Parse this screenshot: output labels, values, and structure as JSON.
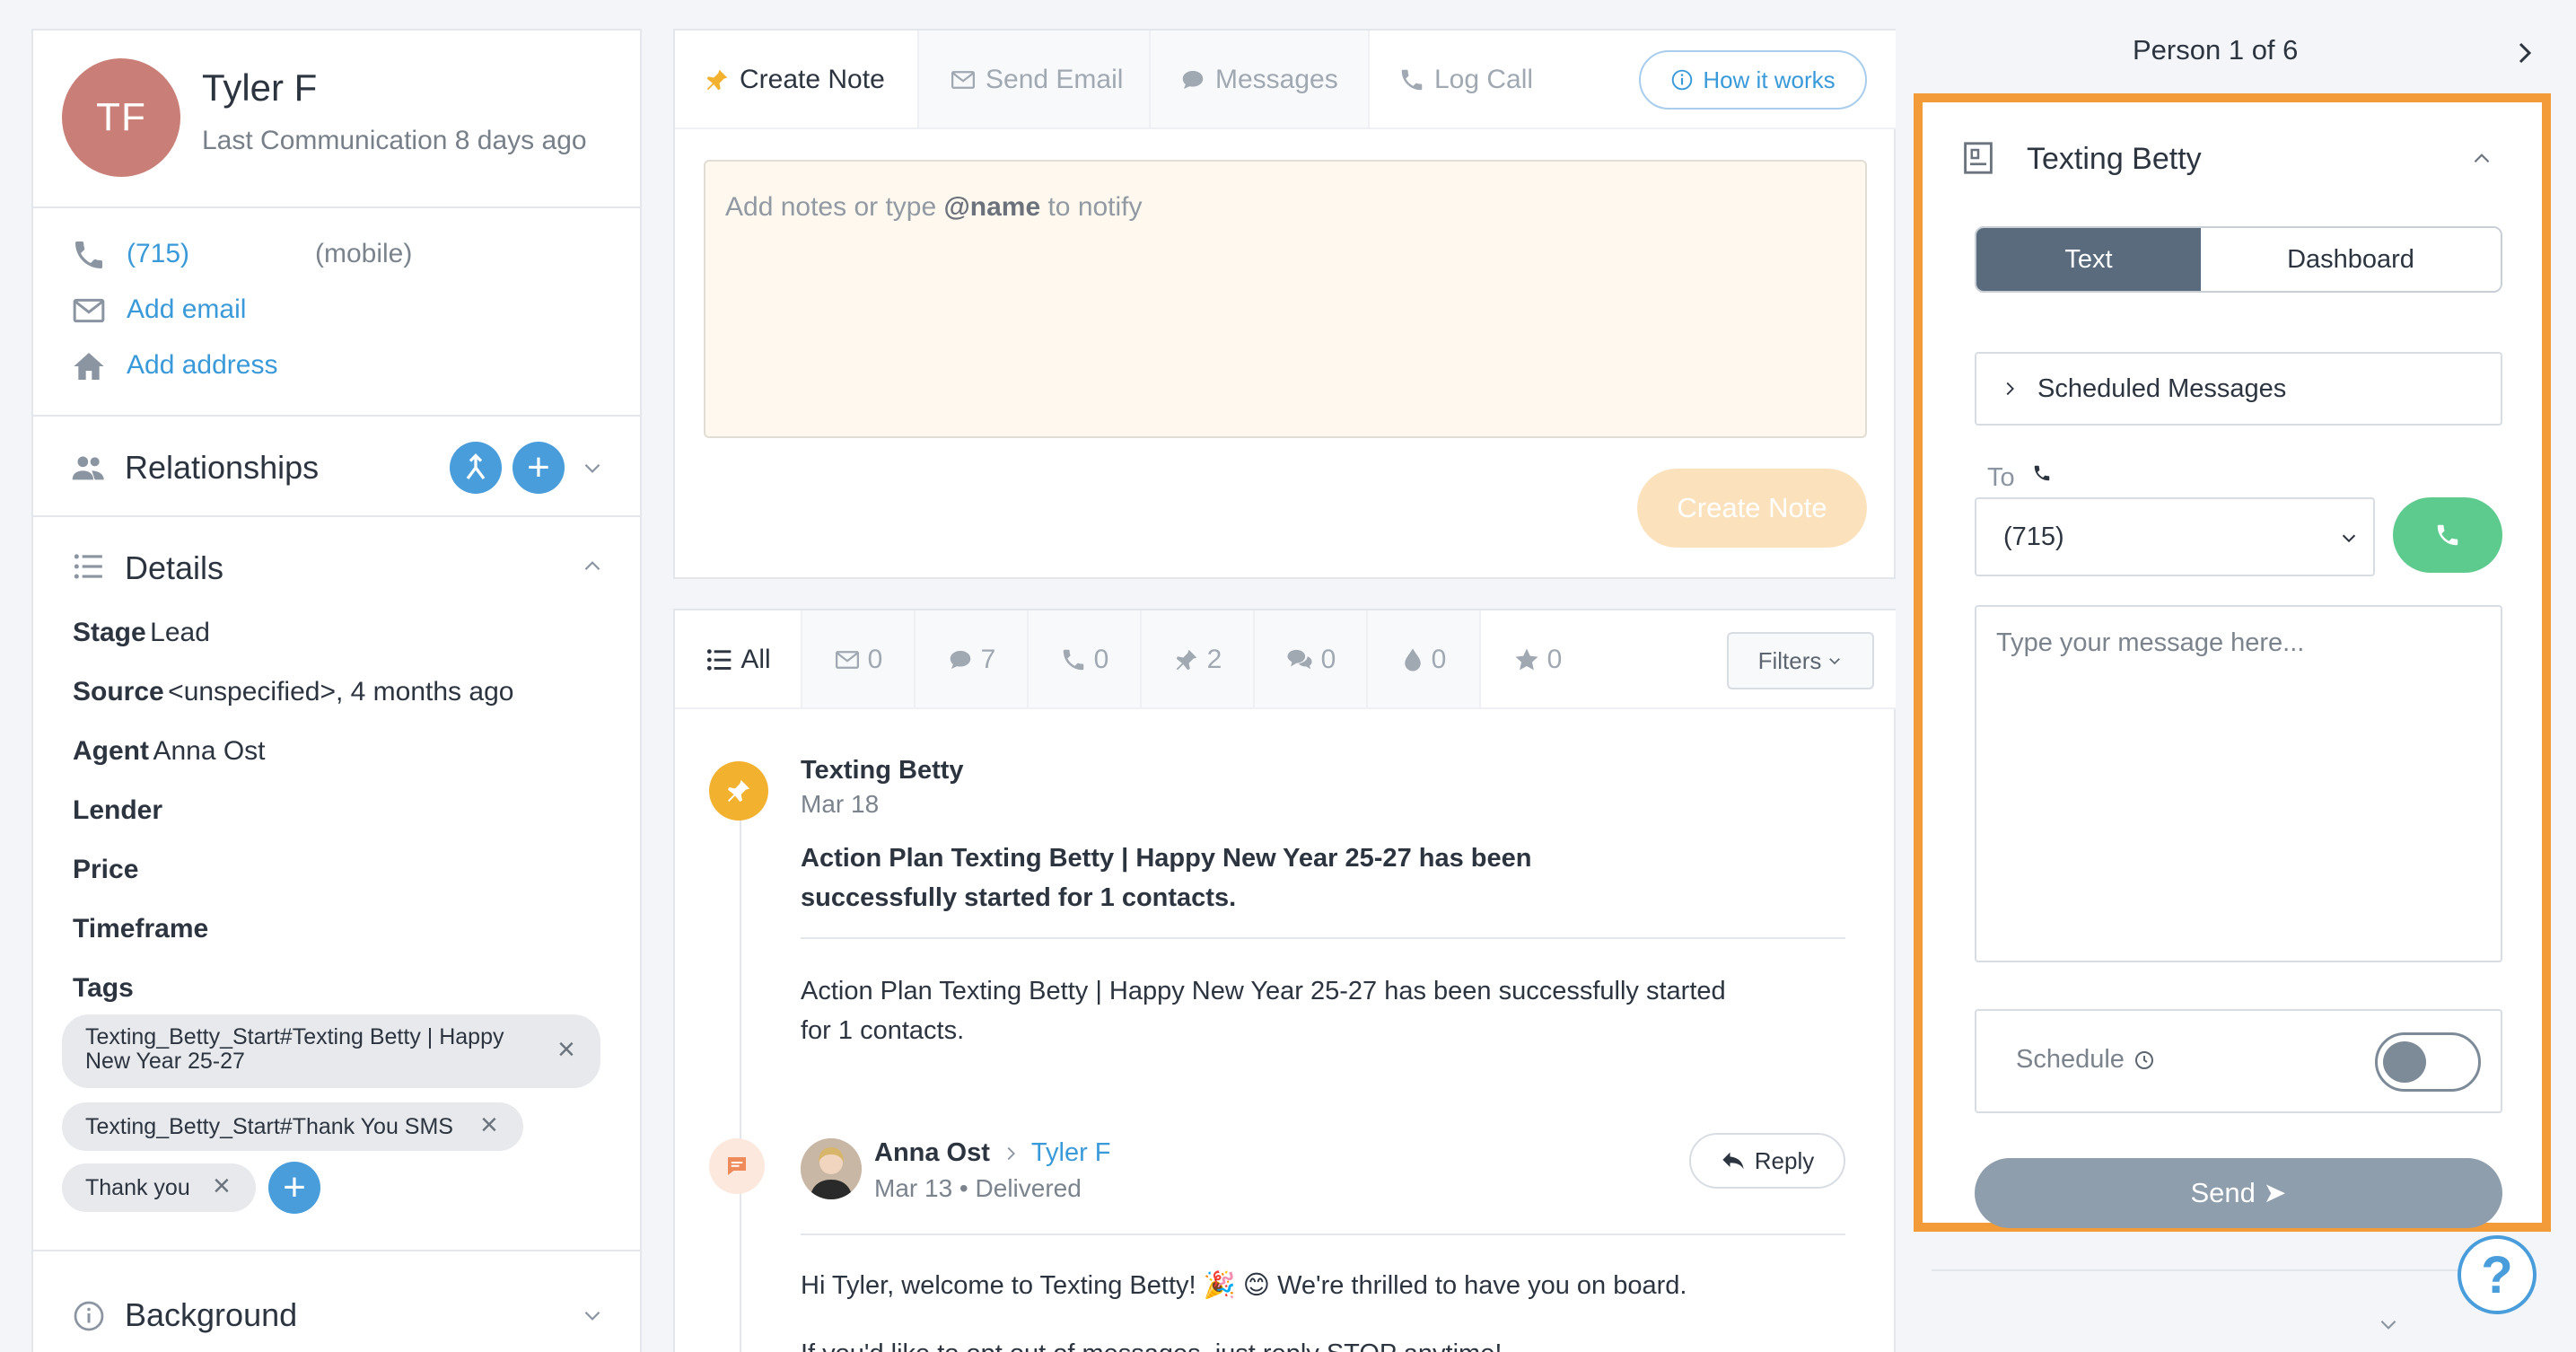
{
  "person": {
    "initials": "TF",
    "name": "Tyler F",
    "last_communication": "Last Communication 8 days ago",
    "phone": "(715)",
    "phone_type": "(mobile)",
    "add_email": "Add email",
    "add_address": "Add address"
  },
  "sections": {
    "relationships": "Relationships",
    "details": "Details",
    "background": "Background"
  },
  "details": [
    {
      "label": "Stage",
      "value": "Lead"
    },
    {
      "label": "Source",
      "value": "<unspecified>, 4 months ago"
    },
    {
      "label": "Agent",
      "value": "Anna Ost"
    },
    {
      "label": "Lender",
      "value": ""
    },
    {
      "label": "Price",
      "value": ""
    },
    {
      "label": "Timeframe",
      "value": ""
    },
    {
      "label": "Tags",
      "value": ""
    }
  ],
  "tags": [
    {
      "line1": "Texting_Betty_Start#Texting Betty | Happy",
      "line2": "New Year 25-27"
    },
    {
      "line1": "Texting_Betty_Start#Thank You SMS",
      "line2": ""
    },
    {
      "line1": "Thank you",
      "line2": ""
    }
  ],
  "composer": {
    "tabs": [
      "Create Note",
      "Send Email",
      "Messages",
      "Log Call"
    ],
    "how_it_works": "How it works",
    "note_placeholder_pre": "Add notes or type ",
    "note_placeholder_bold": "@name",
    "note_placeholder_post": " to notify",
    "create_button": "Create Note"
  },
  "feed_filters": {
    "all": "All",
    "counts": [
      "0",
      "7",
      "0",
      "2",
      "0",
      "0",
      "0"
    ],
    "filters_label": "Filters"
  },
  "feed": [
    {
      "author": "Texting Betty",
      "date": "Mar 18",
      "bold_line1": "Action Plan Texting Betty | Happy New Year 25-27 has been",
      "bold_line2": "successfully started for 1 contacts.",
      "text_line1": "Action Plan Texting Betty | Happy New Year 25-27 has been successfully started",
      "text_line2": "for 1 contacts."
    },
    {
      "author": "Anna Ost",
      "recipient": "Tyler F",
      "date": "Mar 13",
      "status": "Delivered",
      "reply_label": "Reply",
      "text_line1": "Hi Tyler, welcome to Texting Betty! 🎉 😊 We're thrilled to have you on board.",
      "text_line2": "If you'd like to opt out of messages, just reply STOP anytime!"
    }
  ],
  "pager": {
    "label": "Person 1 of 6"
  },
  "texting": {
    "title": "Texting Betty",
    "segments": [
      "Text",
      "Dashboard"
    ],
    "scheduled_messages": "Scheduled Messages",
    "to_label": "To",
    "to_number": "(715)",
    "message_placeholder": "Type your message here...",
    "schedule_label": "Schedule",
    "schedule_enabled": false,
    "send_label": "Send ➤"
  },
  "help": {
    "label": "?"
  },
  "colors": {
    "accent_blue": "#3a9ad9",
    "highlight_orange": "#f29b38",
    "call_green": "#5ecb8e",
    "avatar": "#c97f77"
  }
}
